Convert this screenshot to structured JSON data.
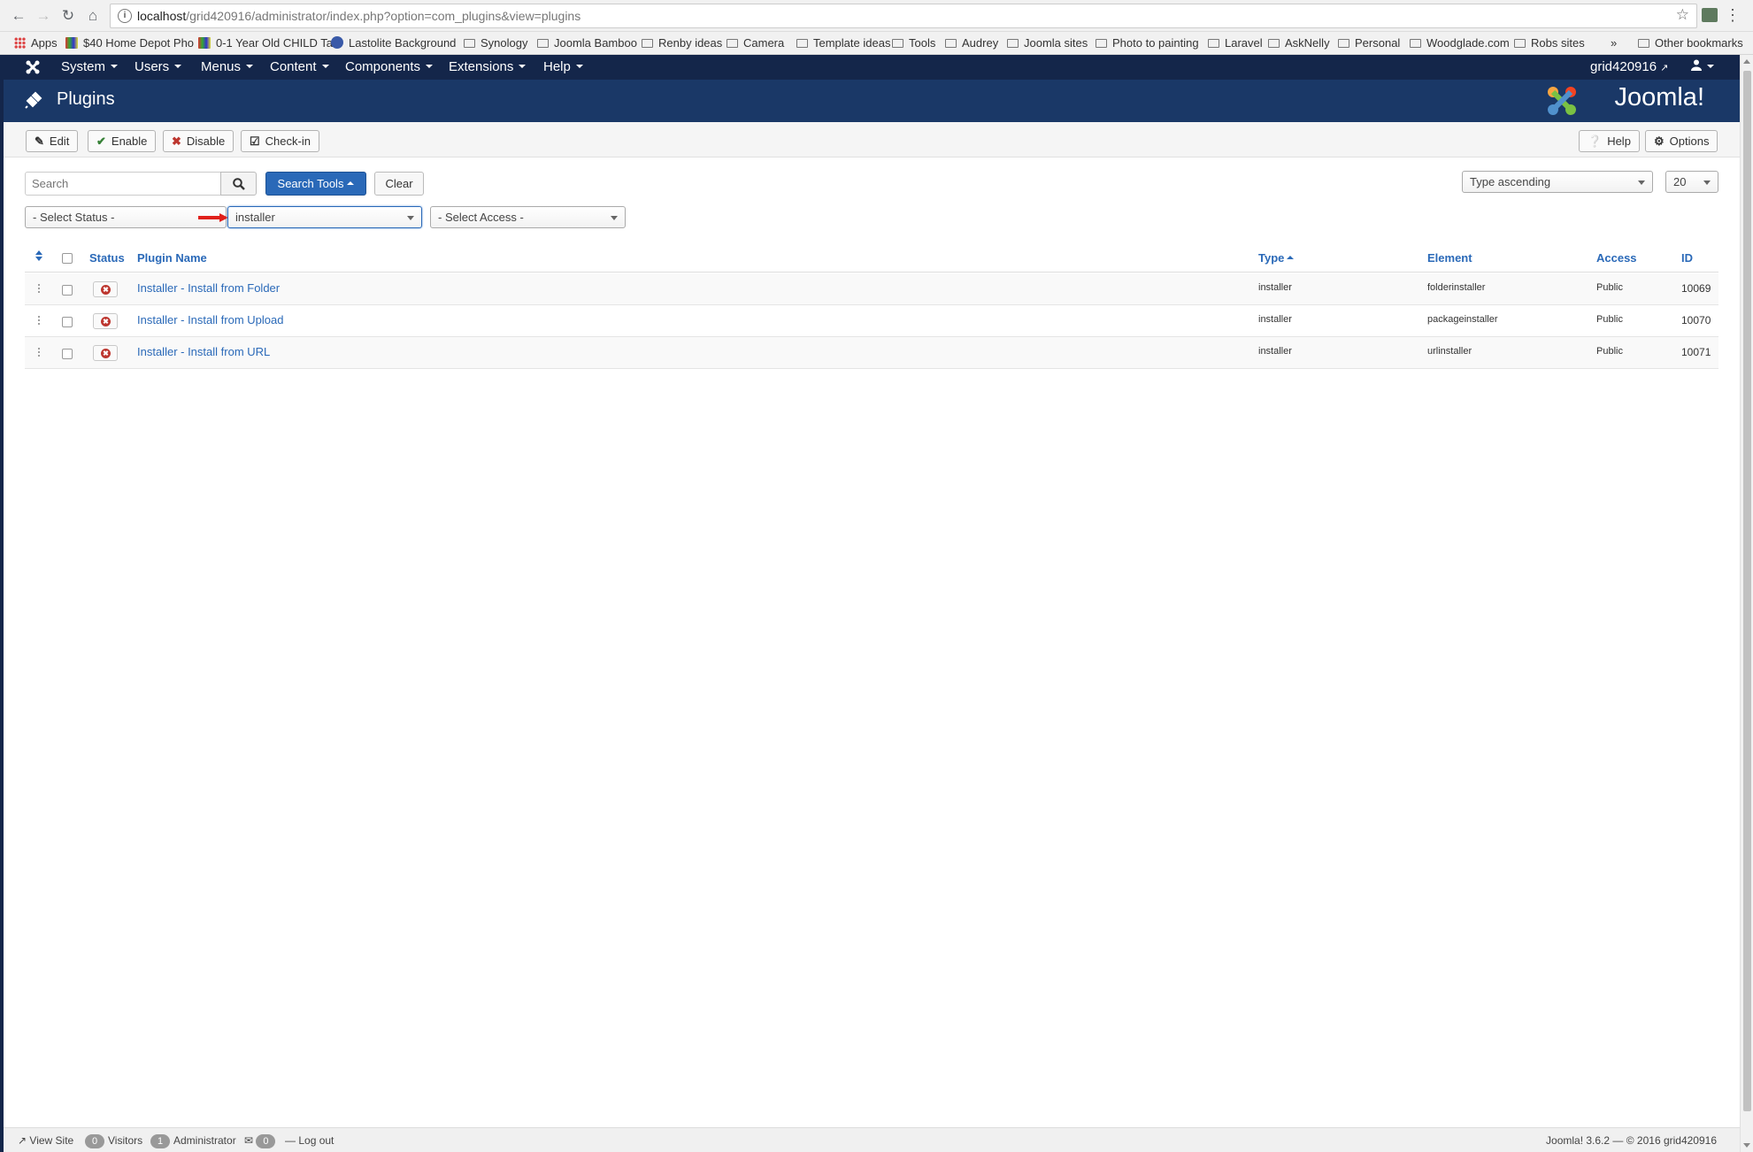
{
  "browser": {
    "url_host": "localhost",
    "url_rest": "/grid420916/administrator/index.php?option=com_plugins&view=plugins",
    "bookmarks": [
      {
        "label": "Apps",
        "icon": "apps-icon"
      },
      {
        "label": "$40 Home Depot Pho",
        "icon": "color-icon"
      },
      {
        "label": "0-1 Year Old CHILD Ta",
        "icon": "color-icon"
      },
      {
        "label": "Lastolite Background",
        "icon": "globe-icon"
      },
      {
        "label": "Synology",
        "icon": "folder-icon"
      },
      {
        "label": "Joomla Bamboo",
        "icon": "folder-icon"
      },
      {
        "label": "Renby ideas",
        "icon": "folder-icon"
      },
      {
        "label": "Camera",
        "icon": "folder-icon"
      },
      {
        "label": "Template ideas",
        "icon": "folder-icon"
      },
      {
        "label": "Tools",
        "icon": "folder-icon"
      },
      {
        "label": "Audrey",
        "icon": "folder-icon"
      },
      {
        "label": "Joomla sites",
        "icon": "folder-icon"
      },
      {
        "label": "Photo to painting",
        "icon": "folder-icon"
      },
      {
        "label": "Laravel",
        "icon": "folder-icon"
      },
      {
        "label": "AskNelly",
        "icon": "folder-icon"
      },
      {
        "label": "Personal",
        "icon": "folder-icon"
      },
      {
        "label": "Woodglade.com",
        "icon": "folder-icon"
      },
      {
        "label": "Robs sites",
        "icon": "folder-icon"
      }
    ],
    "overflow": "»",
    "other_bookmarks": "Other bookmarks"
  },
  "nav": {
    "menus": [
      "System",
      "Users",
      "Menus",
      "Content",
      "Components",
      "Extensions",
      "Help"
    ],
    "site_name": "grid420916"
  },
  "header": {
    "title": "Plugins",
    "brand": "Joomla!"
  },
  "toolbar": {
    "edit": "Edit",
    "enable": "Enable",
    "disable": "Disable",
    "checkin": "Check-in",
    "help": "Help",
    "options": "Options"
  },
  "filters": {
    "search_placeholder": "Search",
    "search_tools": "Search Tools",
    "clear": "Clear",
    "sort": "Type ascending",
    "limit": "20",
    "status": "- Select Status -",
    "type": "installer",
    "access": "- Select Access -"
  },
  "table": {
    "headers": {
      "status": "Status",
      "name": "Plugin Name",
      "type": "Type",
      "element": "Element",
      "access": "Access",
      "id": "ID"
    },
    "rows": [
      {
        "name": "Installer - Install from Folder",
        "type": "installer",
        "element": "folderinstaller",
        "access": "Public",
        "id": "10069",
        "enabled": false
      },
      {
        "name": "Installer - Install from Upload",
        "type": "installer",
        "element": "packageinstaller",
        "access": "Public",
        "id": "10070",
        "enabled": false
      },
      {
        "name": "Installer - Install from URL",
        "type": "installer",
        "element": "urlinstaller",
        "access": "Public",
        "id": "10071",
        "enabled": false
      }
    ]
  },
  "footer": {
    "view_site": "View Site",
    "visitors_count": "0",
    "visitors": "Visitors",
    "admins_count": "1",
    "admins": "Administrator",
    "messages_count": "0",
    "logout": "Log out",
    "version": "Joomla! 3.6.2 — © 2016 grid420916"
  }
}
